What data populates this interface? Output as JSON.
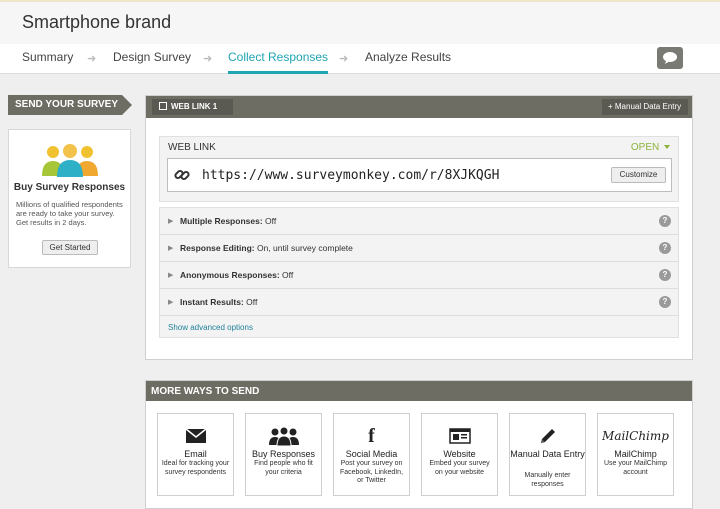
{
  "survey": {
    "title": "Smartphone brand"
  },
  "steps": [
    {
      "label": "Summary"
    },
    {
      "label": "Design Survey"
    },
    {
      "label": "Collect Responses"
    },
    {
      "label": "Analyze Results"
    }
  ],
  "step_arrow": "➜",
  "sidebar": {
    "send_label": "SEND YOUR SURVEY",
    "buy": {
      "title": "Buy Survey Responses",
      "description": "Millions of qualified respondents are ready to take your survey. Get results in 2 days.",
      "button": "Get Started"
    }
  },
  "weblink": {
    "tab_label": "WEB LINK 1",
    "manual_entry_label": "+ Manual Data Entry",
    "section_label": "WEB LINK",
    "status": "OPEN",
    "url": "https://www.surveymonkey.com/r/8XJKQGH",
    "customize_label": "Customize",
    "options": [
      {
        "name": "Multiple Responses:",
        "value": " Off"
      },
      {
        "name": "Response Editing:",
        "value": " On, until survey complete"
      },
      {
        "name": "Anonymous Responses:",
        "value": " Off"
      },
      {
        "name": "Instant Results:",
        "value": " Off"
      }
    ],
    "help_glyph": "?",
    "advanced_link": "Show advanced options"
  },
  "more_ways": {
    "header": "MORE WAYS TO SEND",
    "cards": [
      {
        "title": "Email",
        "description": "Ideal for tracking your survey respondents"
      },
      {
        "title": "Buy Responses",
        "description": "Find people who fit your criteria"
      },
      {
        "title": "Social Media",
        "description": "Post your survey on Facebook, LinkedIn, or Twitter"
      },
      {
        "title": "Website",
        "description": "Embed your survey on your website"
      },
      {
        "title": "Manual Data Entry",
        "description": "Manually enter responses"
      },
      {
        "title": "MailChimp",
        "description": "Use your MailChimp account",
        "logo_text": "MailChimp"
      }
    ]
  },
  "colors": {
    "accent": "#20a5b2",
    "header_bar": "#6d6d63",
    "open_status": "#8cb43a",
    "link": "#20809a"
  }
}
